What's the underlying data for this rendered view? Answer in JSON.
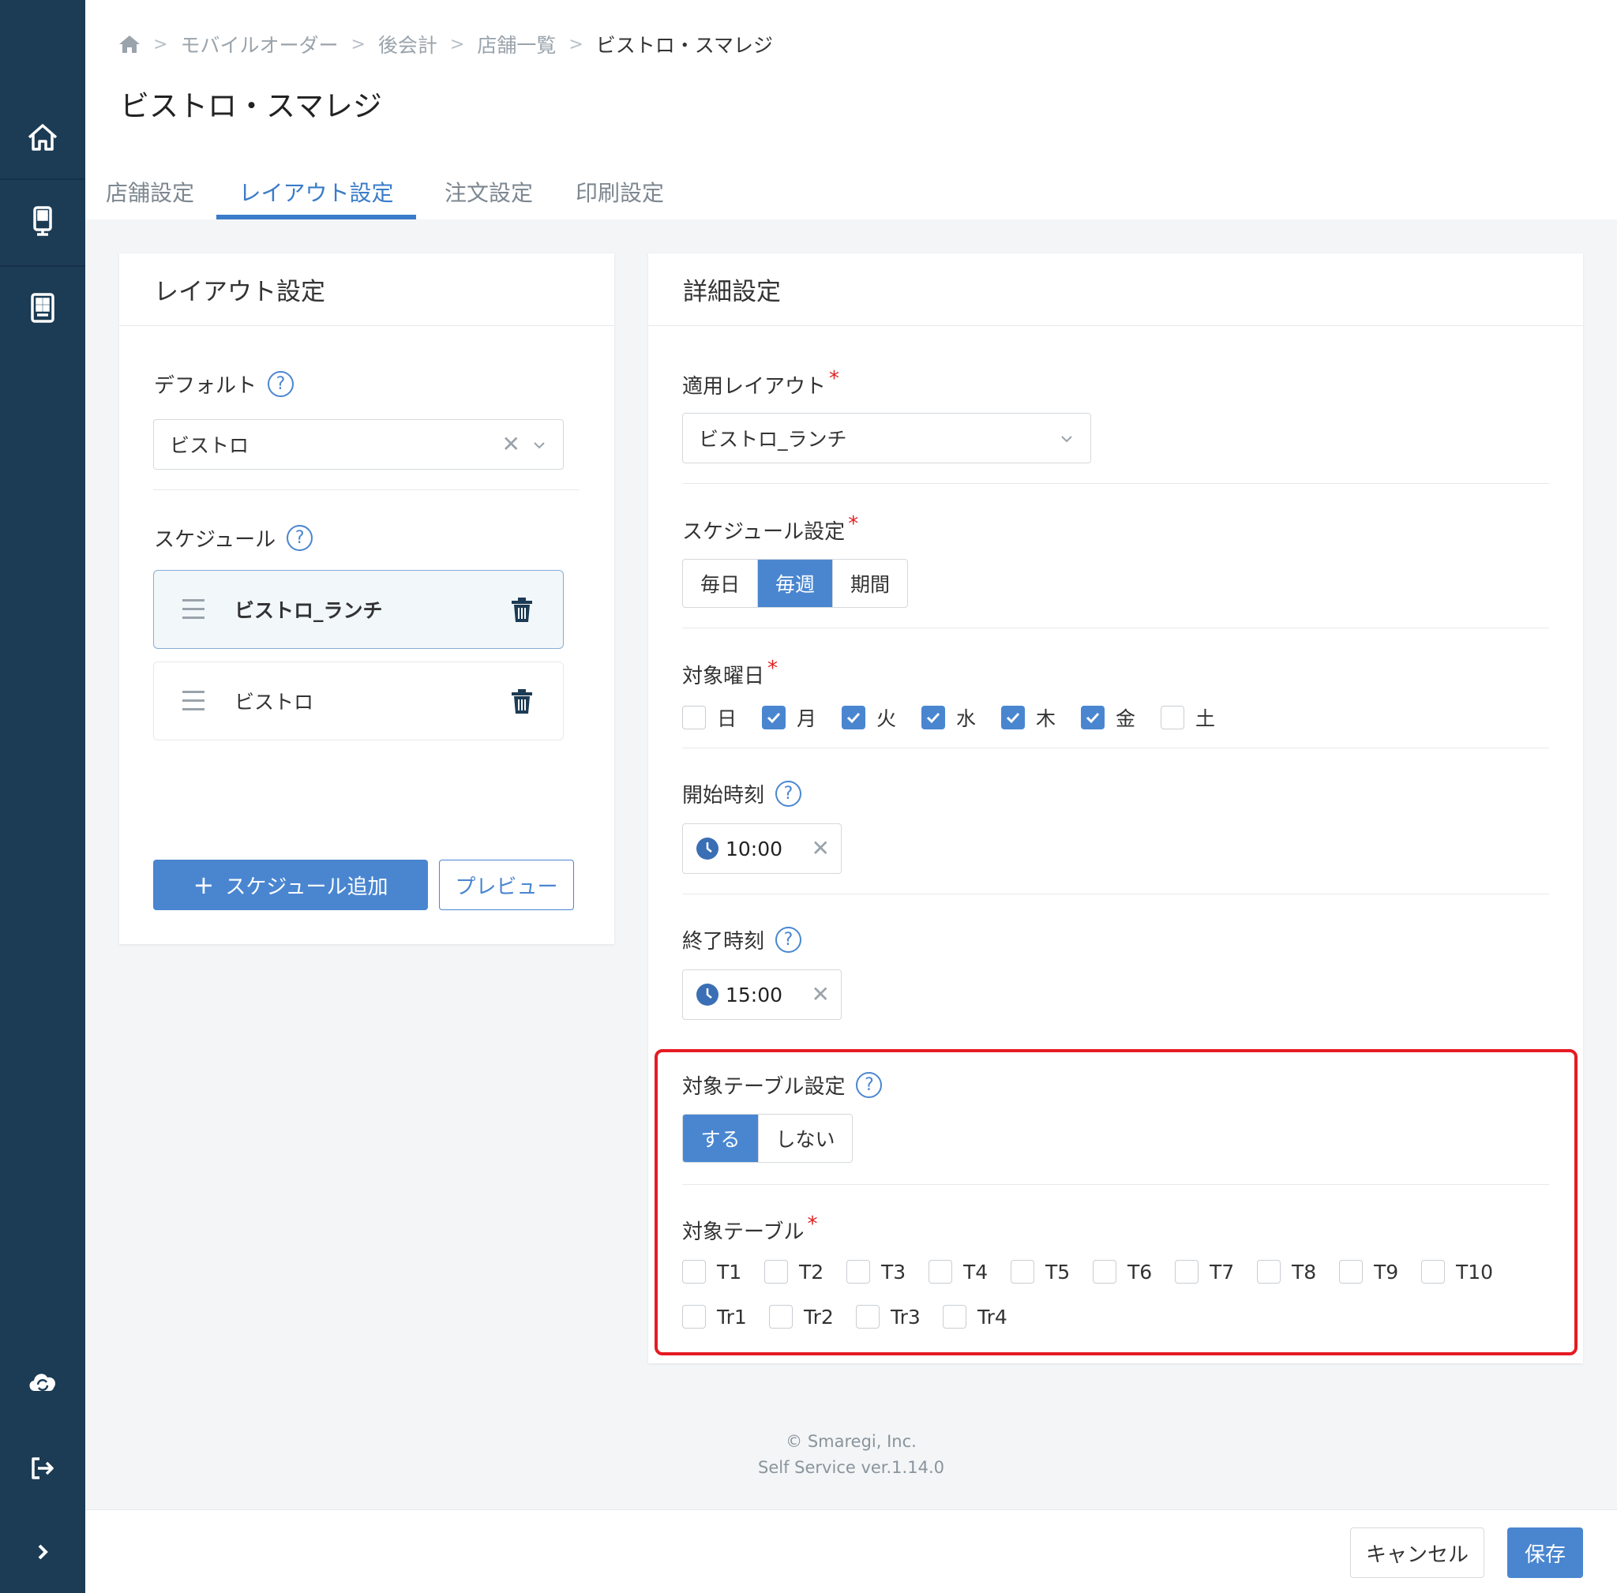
{
  "breadcrumb": {
    "items": [
      "モバイルオーダー",
      "後会計",
      "店舗一覧"
    ],
    "current": "ビストロ・スマレジ"
  },
  "page_title": "ビストロ・スマレジ",
  "tabs": [
    "店舗設定",
    "レイアウト設定",
    "注文設定",
    "印刷設定"
  ],
  "layout_card": {
    "title": "レイアウト設定",
    "default_label": "デフォルト",
    "default_value": "ビストロ",
    "schedule_label": "スケジュール",
    "schedules": [
      "ビストロ_ランチ",
      "ビストロ"
    ],
    "add_button": "スケジュール追加",
    "preview_button": "プレビュー"
  },
  "detail_card": {
    "title": "詳細設定",
    "apply_layout_label": "適用レイアウト",
    "apply_layout_value": "ビストロ_ランチ",
    "schedule_setting_label": "スケジュール設定",
    "schedule_options": [
      "毎日",
      "毎週",
      "期間"
    ],
    "schedule_selected": "毎週",
    "weekday_label": "対象曜日",
    "weekdays": [
      {
        "label": "日",
        "checked": false
      },
      {
        "label": "月",
        "checked": true
      },
      {
        "label": "火",
        "checked": true
      },
      {
        "label": "水",
        "checked": true
      },
      {
        "label": "木",
        "checked": true
      },
      {
        "label": "金",
        "checked": true
      },
      {
        "label": "土",
        "checked": false
      }
    ],
    "start_label": "開始時刻",
    "start_value": "10:00",
    "end_label": "終了時刻",
    "end_value": "15:00",
    "table_setting_label": "対象テーブル設定",
    "table_setting_options": [
      "する",
      "しない"
    ],
    "table_setting_selected": "する",
    "tables_label": "対象テーブル",
    "tables_row1": [
      "T1",
      "T2",
      "T3",
      "T4",
      "T5",
      "T6",
      "T7",
      "T8",
      "T9",
      "T10"
    ],
    "tables_row2": [
      "Tr1",
      "Tr2",
      "Tr3",
      "Tr4"
    ]
  },
  "footer": {
    "copyright": "© Smaregi, Inc.",
    "version": "Self Service ver.1.14.0"
  },
  "actions": {
    "cancel": "キャンセル",
    "save": "保存"
  },
  "colors": {
    "accent": "#4a86d0",
    "sidebar": "#1c3b54",
    "highlight": "#e51b23"
  },
  "icons": {
    "sidebar": [
      "home-icon",
      "kiosk-icon",
      "tablet-icon",
      "cloud-sync-icon",
      "logout-icon",
      "chevron-right-icon"
    ]
  }
}
